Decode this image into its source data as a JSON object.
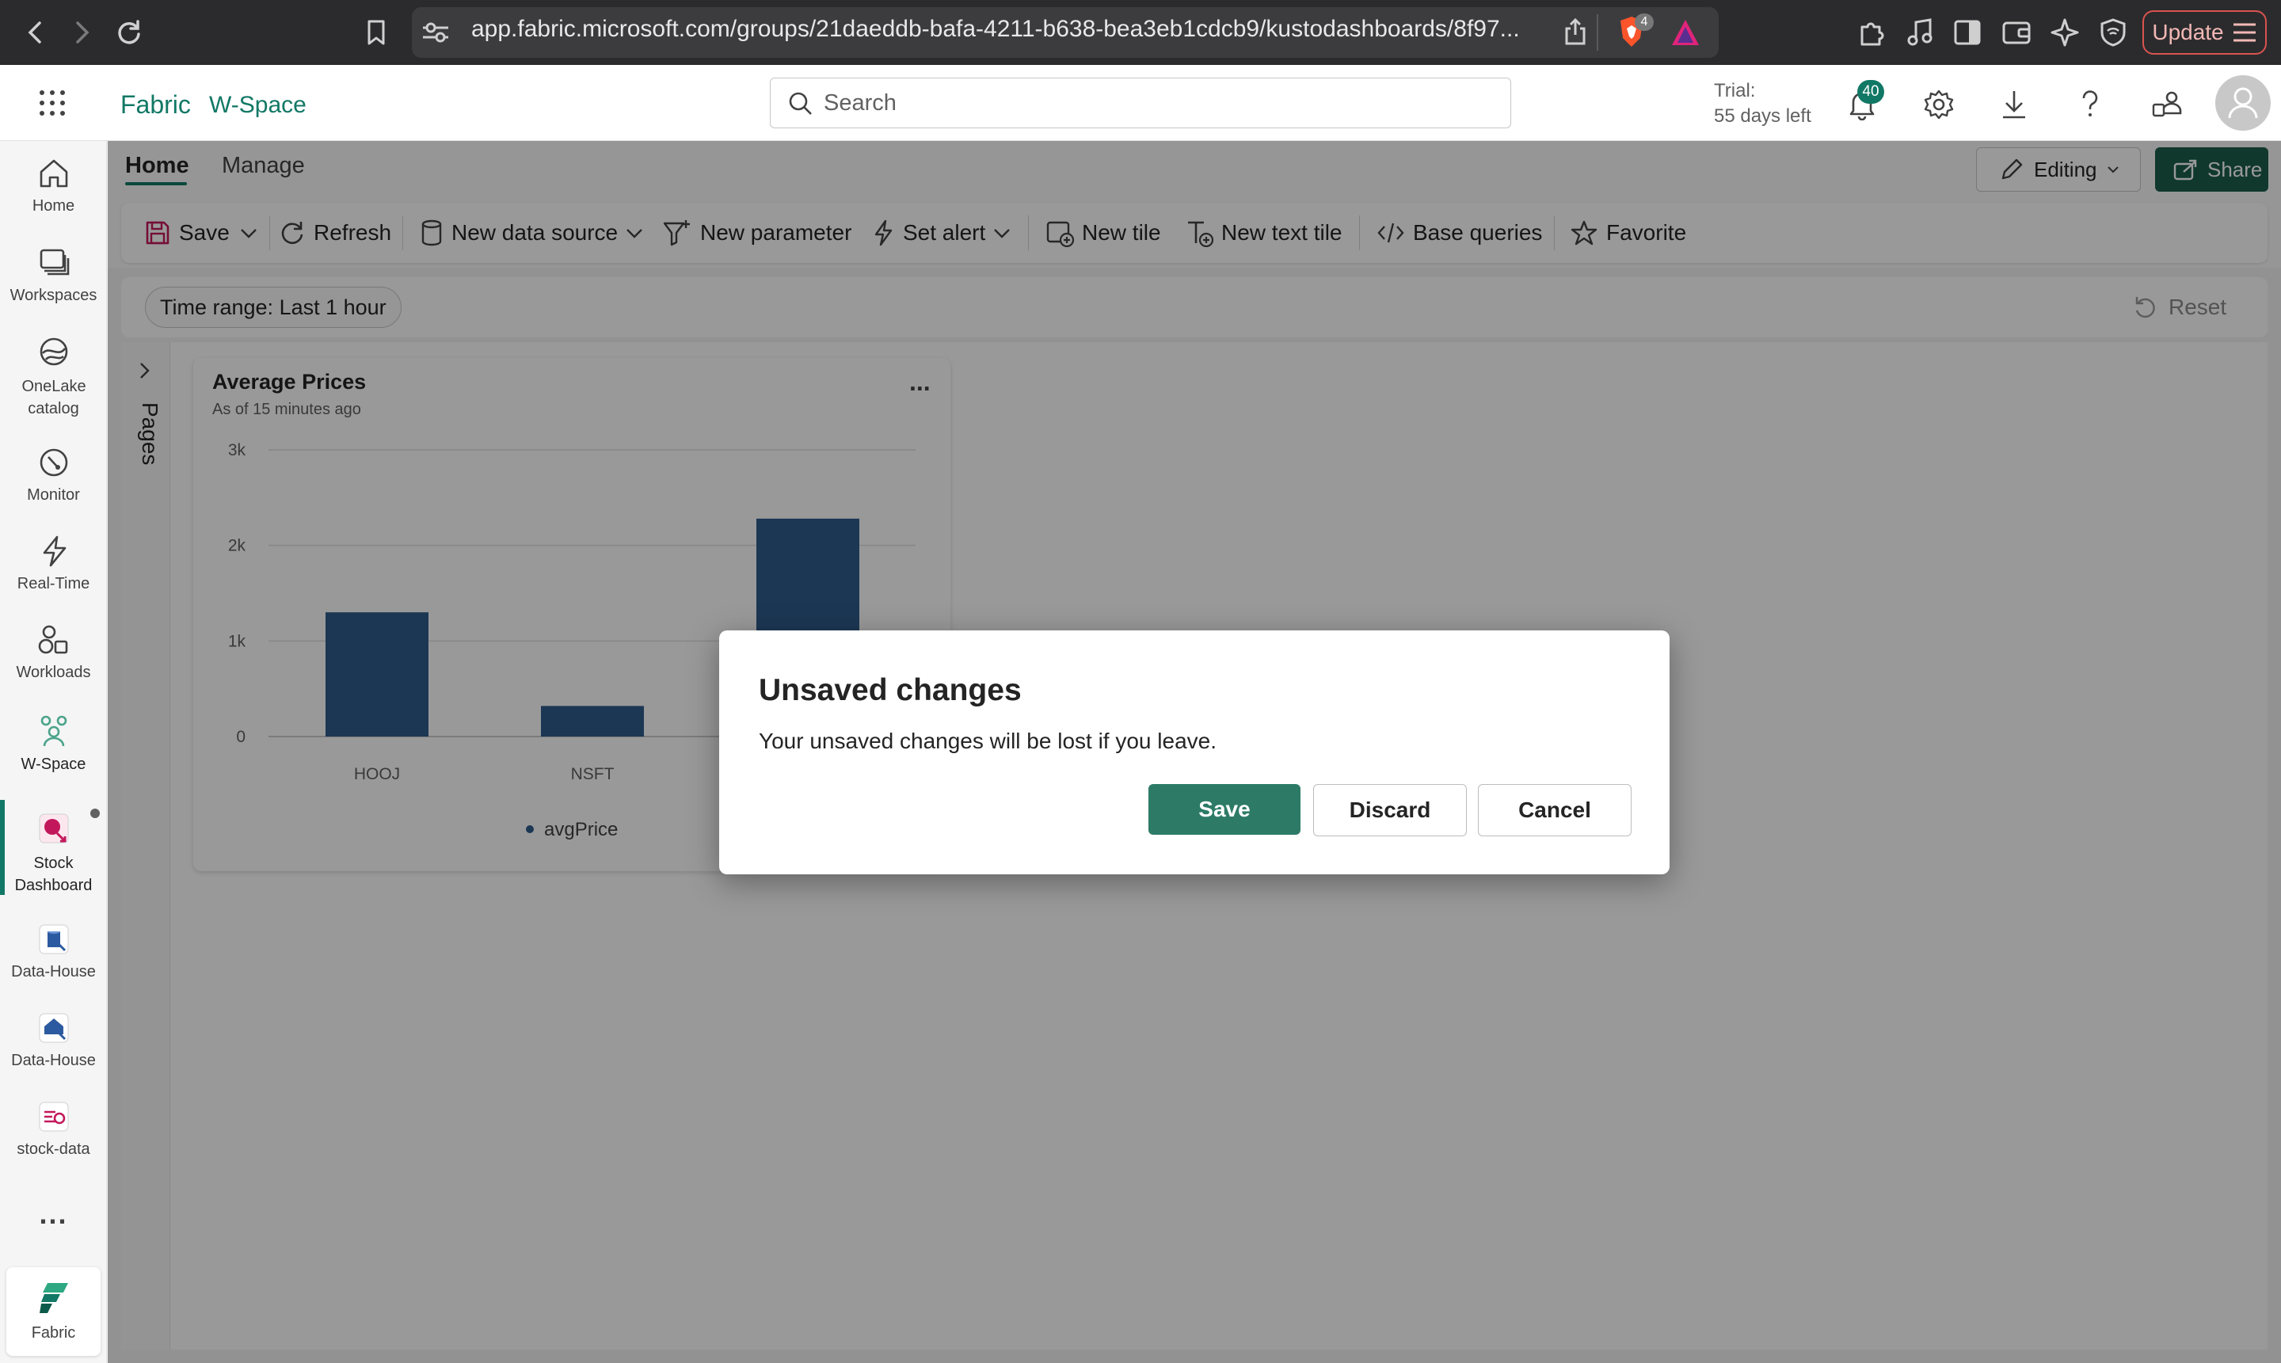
{
  "browser": {
    "url": "app.fabric.microsoft.com/groups/21daeddb-bafa-4211-b638-bea3eb1cdcb9/kustodashboards/8f97...",
    "shield_badge": "4",
    "update_label": "Update"
  },
  "header": {
    "app_name": "Fabric",
    "workspace": "W-Space",
    "search_placeholder": "Search",
    "trial_line1": "Trial:",
    "trial_line2": "55 days left",
    "notification_count": "40"
  },
  "rail": {
    "items": [
      {
        "label": "Home",
        "icon": "home-icon"
      },
      {
        "label": "Workspaces",
        "icon": "workspaces-icon"
      },
      {
        "label": "OneLake catalog",
        "icon": "onelake-icon"
      },
      {
        "label": "Monitor",
        "icon": "monitor-icon"
      },
      {
        "label": "Real-Time",
        "icon": "realtime-icon"
      },
      {
        "label": "Workloads",
        "icon": "workloads-icon"
      },
      {
        "label": "W-Space",
        "icon": "workspace-people-icon"
      },
      {
        "label": "Stock Dashboard",
        "icon": "dashboard-icon"
      },
      {
        "label": "Data-House",
        "icon": "eventhouse-icon"
      },
      {
        "label": "Data-House",
        "icon": "kql-database-icon"
      },
      {
        "label": "stock-data",
        "icon": "eventstream-icon"
      }
    ],
    "more_label": "...",
    "bottom_label": "Fabric"
  },
  "tabs": {
    "home": "Home",
    "manage": "Manage"
  },
  "editing_label": "Editing",
  "share_label": "Share",
  "toolbar": {
    "save": "Save",
    "refresh": "Refresh",
    "new_data_source": "New data source",
    "new_parameter": "New parameter",
    "set_alert": "Set alert",
    "new_tile": "New tile",
    "new_text_tile": "New text tile",
    "base_queries": "Base queries",
    "favorite": "Favorite"
  },
  "filters": {
    "time_range_label": "Time range:",
    "time_range_value": "Last 1 hour",
    "reset_label": "Reset"
  },
  "pages_label": "Pages",
  "tile": {
    "title": "Average Prices",
    "subtitle": "As of 15 minutes ago",
    "menu": "..."
  },
  "chart_data": {
    "type": "bar",
    "categories": [
      "HOOJ",
      "NSFT",
      ""
    ],
    "series": [
      {
        "name": "avgPrice",
        "values": [
          1300,
          320,
          2280
        ]
      }
    ],
    "yticks": [
      "0",
      "1k",
      "2k",
      "3k"
    ],
    "ylim": [
      0,
      3000
    ],
    "legend": "bottom",
    "grid": true,
    "color": "#2f5d8c"
  },
  "dialog": {
    "title": "Unsaved changes",
    "message": "Your unsaved changes will be lost if you leave.",
    "save": "Save",
    "discard": "Discard",
    "cancel": "Cancel"
  },
  "colors": {
    "accent": "#117865",
    "primary_button": "#2d7b67",
    "share_button": "#1b5e4c",
    "bar": "#2f5d8c"
  }
}
